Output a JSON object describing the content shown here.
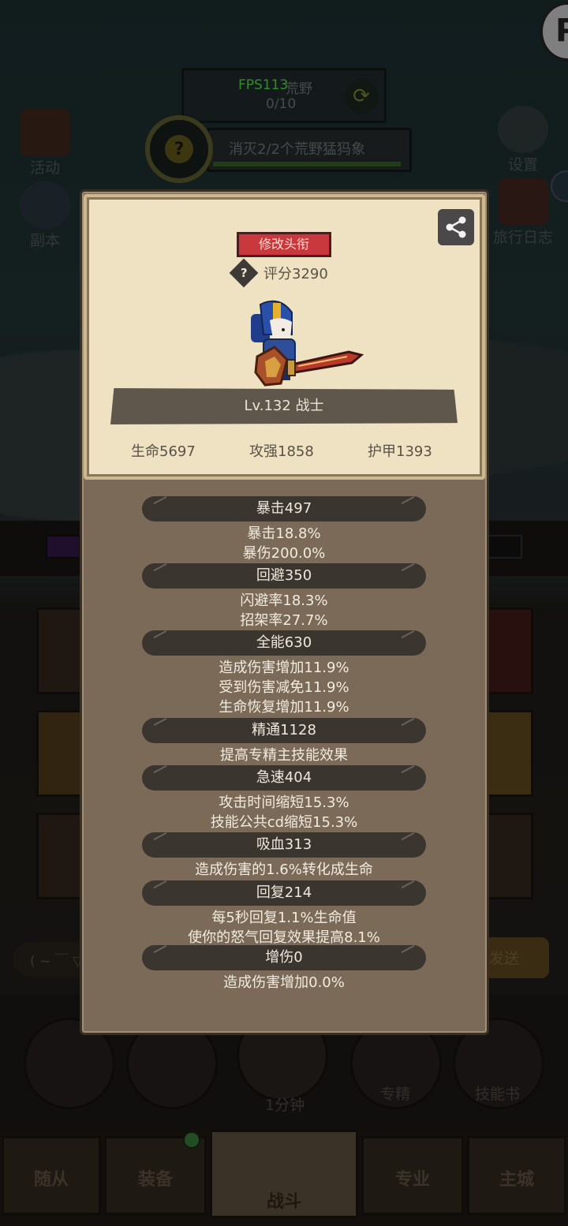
{
  "hud": {
    "fps": "FPS113",
    "area_name": "荒野",
    "area_progress": "0/10",
    "quest_text": "消灭2/2个荒野猛犸象",
    "quest_help_icon": "question-icon",
    "p_badge": "P"
  },
  "side_left": [
    {
      "label": "活动",
      "icon": "event-book-icon"
    },
    {
      "label": "副本",
      "icon": "dungeon-portal-icon"
    }
  ],
  "side_right": [
    {
      "label": "设置",
      "icon": "gear-icon"
    },
    {
      "label": "旅行日志",
      "icon": "journal-icon"
    }
  ],
  "chat": {
    "input": "( ~ ￣ ▽",
    "send": "发送"
  },
  "bottom_buttons": [
    {
      "label": "",
      "icon": "potion-icon"
    },
    {
      "label": "",
      "icon": "meat-icon"
    },
    {
      "label": "1分钟",
      "icon": "chest-icon"
    },
    {
      "label": "专精",
      "icon": "specialization-icon"
    },
    {
      "label": "技能书",
      "icon": "skill-book-icon"
    }
  ],
  "nav": [
    "随从",
    "装备",
    "战斗",
    "专业",
    "主城"
  ],
  "nav_active": "战斗",
  "card": {
    "title_button": "修改头衔",
    "score": "评分3290",
    "level": "Lv.132 战士",
    "hp": "生命5697",
    "attack": "攻强1858",
    "armor": "护甲1393"
  },
  "stats": [
    {
      "header": "暴击497",
      "lines": [
        "暴击18.8%",
        "暴伤200.0%"
      ]
    },
    {
      "header": "回避350",
      "lines": [
        "闪避率18.3%",
        "招架率27.7%"
      ]
    },
    {
      "header": "全能630",
      "lines": [
        "造成伤害增加11.9%",
        "受到伤害减免11.9%",
        "生命恢复增加11.9%"
      ]
    },
    {
      "header": "精通1128",
      "lines": [
        "提高专精主技能效果"
      ]
    },
    {
      "header": "急速404",
      "lines": [
        "攻击时间缩短15.3%",
        "技能公共cd缩短15.3%"
      ]
    },
    {
      "header": "吸血313",
      "lines": [
        "造成伤害的1.6%转化成生命"
      ]
    },
    {
      "header": "回复214",
      "lines": [
        "每5秒回复1.1%生命值",
        "使你的怒气回复效果提高8.1%"
      ]
    },
    {
      "header": "增伤0",
      "lines": [
        "造成伤害增加0.0%"
      ]
    }
  ],
  "colors": {
    "panel": "#7a6a57",
    "card": "#efe2c2",
    "header_pill": "#3b3530",
    "title_button": "#c8383c",
    "fps": "#5cff4a"
  }
}
